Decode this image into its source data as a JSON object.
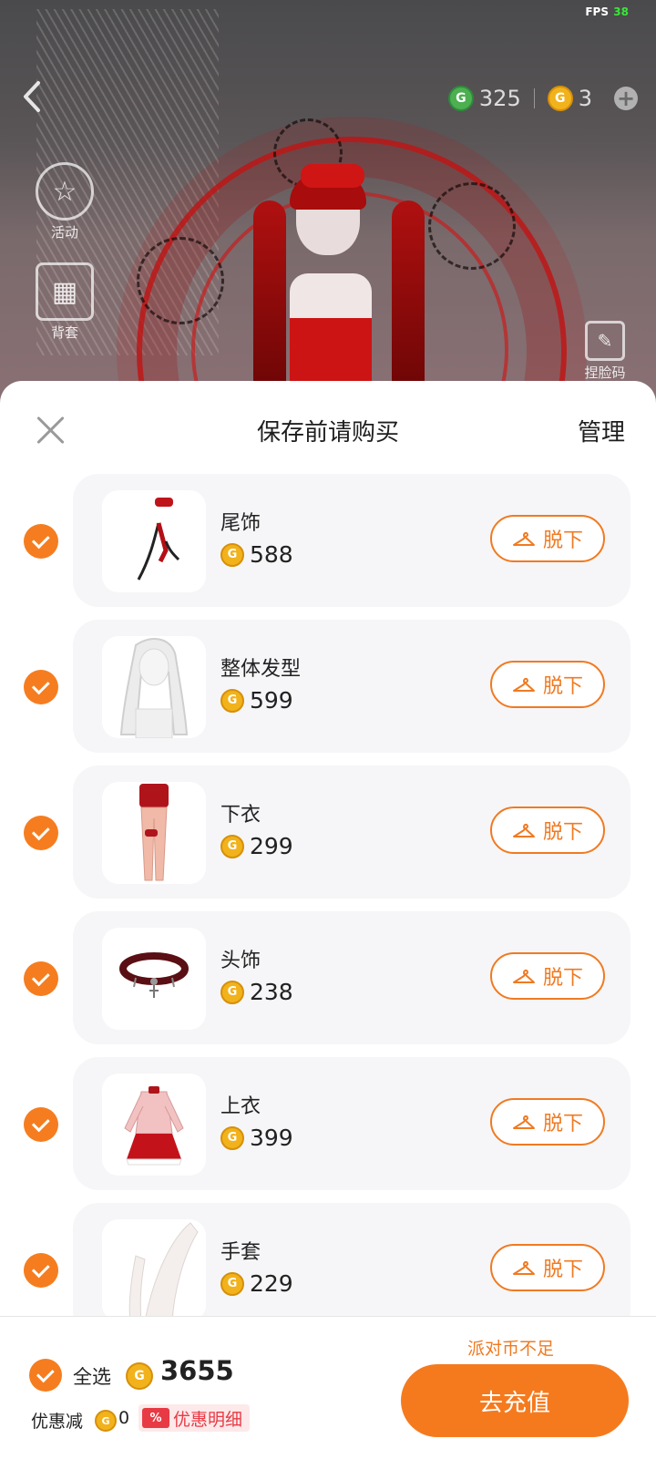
{
  "status": {
    "fps_label": "FPS",
    "fps_value": "38"
  },
  "top": {
    "green_currency": "325",
    "gold_currency": "3",
    "side_activity": "活动",
    "side_gift": "背套",
    "side_face": "捏脸码"
  },
  "sheet": {
    "title": "保存前请购买",
    "manage": "管理",
    "remove_label": "脱下",
    "items": [
      {
        "name": "尾饰",
        "price": "588",
        "icon": "tail-accessory"
      },
      {
        "name": "整体发型",
        "price": "599",
        "icon": "hairstyle"
      },
      {
        "name": "下衣",
        "price": "299",
        "icon": "bottoms"
      },
      {
        "name": "头饰",
        "price": "238",
        "icon": "choker-headwear"
      },
      {
        "name": "上衣",
        "price": "399",
        "icon": "top-outfit"
      },
      {
        "name": "手套",
        "price": "229",
        "icon": "gloves"
      }
    ]
  },
  "footer": {
    "insufficient": "派对币不足",
    "select_all": "全选",
    "total": "3655",
    "discount_label": "优惠减",
    "discount_value": "0",
    "discount_detail": "优惠明细",
    "discount_badge": "%",
    "recharge": "去充值"
  },
  "colors": {
    "accent": "#f57d1f",
    "coin": "#f2b21b",
    "green_coin": "#4caf50",
    "promo": "#e83a45"
  }
}
